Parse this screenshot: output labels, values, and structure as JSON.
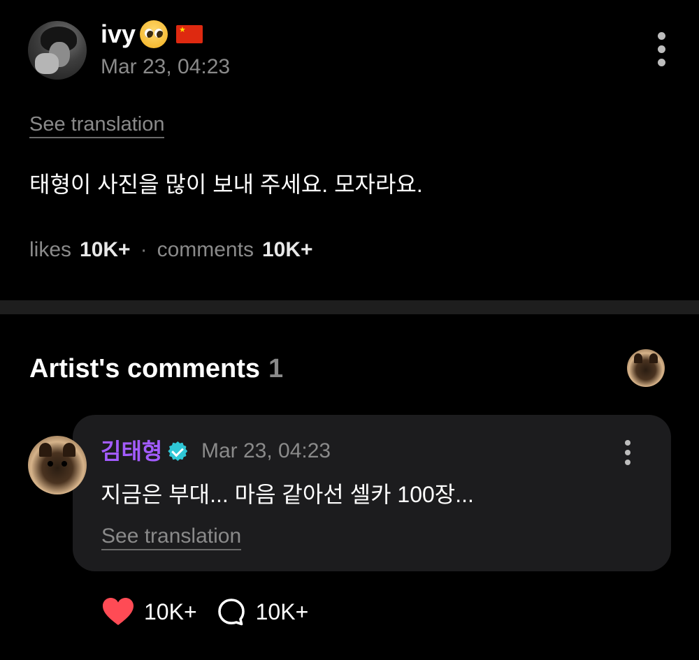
{
  "post": {
    "username": "ivy",
    "flag_label": "★",
    "date": "Mar 23, 04:23",
    "see_translation": "See translation",
    "body": "태형이 사진을 많이 보내 주세요. 모자라요.",
    "likes_label": "likes",
    "likes_count": "10K+",
    "separator": "·",
    "comments_label": "comments",
    "comments_count": "10K+"
  },
  "artist_comments": {
    "title": "Artist's comments",
    "count": "1",
    "comment": {
      "author": "김태형",
      "date": "Mar 23, 04:23",
      "text": "지금은 부대... 마음 같아선 셀카 100장...",
      "see_translation": "See translation",
      "like_count": "10K+",
      "reply_count": "10K+"
    }
  },
  "colors": {
    "background": "#000000",
    "card": "#1c1c1e",
    "artist_name": "#a35cff",
    "verified": "#2fc7d6",
    "heart": "#ff4b55",
    "muted_text": "#8a8a8a"
  },
  "icons": [
    "pleading-face-emoji",
    "china-flag-icon",
    "more-vertical-icon",
    "verified-badge-icon",
    "heart-icon",
    "comment-bubble-icon"
  ]
}
